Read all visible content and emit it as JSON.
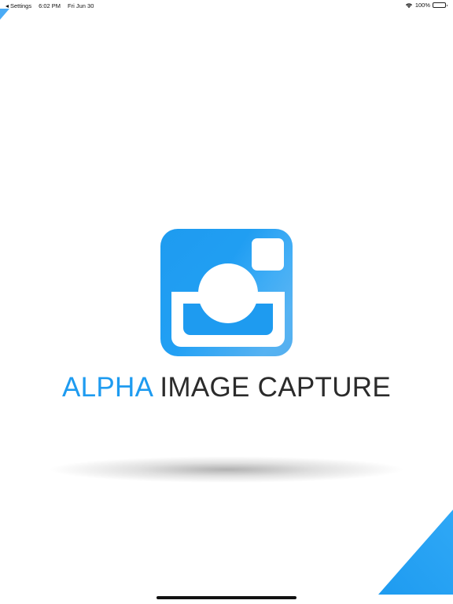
{
  "status_bar": {
    "back_label": "Settings",
    "time": "6:02 PM",
    "date": "Fri Jun 30",
    "battery_percent": "100%",
    "battery_level": 1.0,
    "icons": [
      "back-arrow-icon",
      "wifi-icon",
      "battery-icon"
    ]
  },
  "app": {
    "title_accent": "ALPHA",
    "title_rest": "IMAGE CAPTURE",
    "logo_icon": "camera-logo-icon"
  },
  "colors": {
    "brand_blue": "#1e9bf0",
    "text_dark": "#2b2b2b",
    "background": "#ffffff"
  }
}
